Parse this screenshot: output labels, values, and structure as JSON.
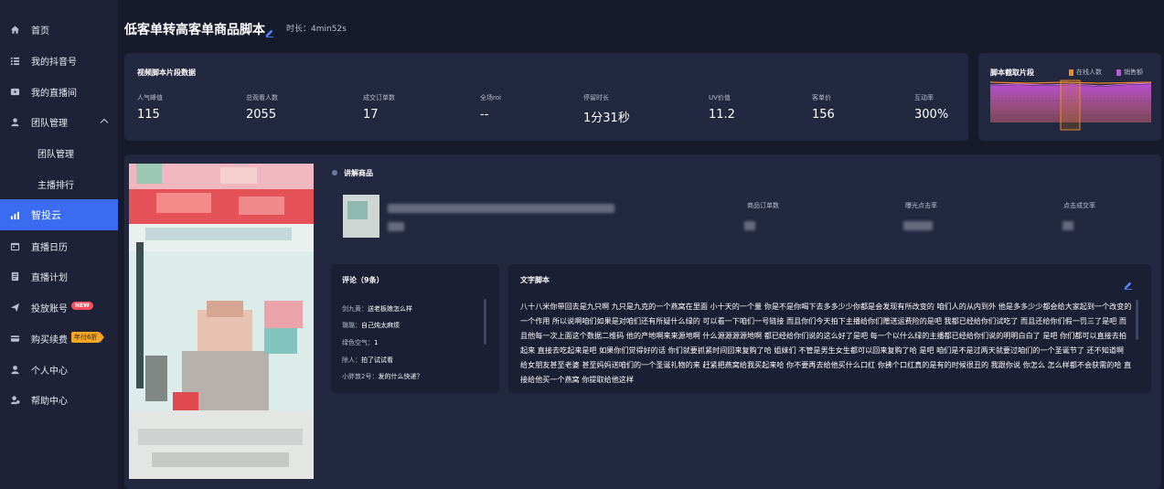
{
  "sidebar": {
    "items": [
      {
        "label": "首页",
        "icon": "home-icon"
      },
      {
        "label": "我的抖音号",
        "icon": "list-icon"
      },
      {
        "label": "我的直播间",
        "icon": "live-icon"
      },
      {
        "label": "团队管理",
        "icon": "team-icon"
      },
      {
        "label": "团队管理",
        "icon": ""
      },
      {
        "label": "主播排行",
        "icon": ""
      },
      {
        "label": "智投云",
        "icon": "chart-icon"
      },
      {
        "label": "直播日历",
        "icon": "calendar-icon"
      },
      {
        "label": "直播计划",
        "icon": "plan-icon"
      },
      {
        "label": "投放账号",
        "icon": "send-icon",
        "badge": "NEW"
      },
      {
        "label": "购买续费",
        "icon": "card-icon",
        "badge": "年付6折"
      },
      {
        "label": "个人中心",
        "icon": "user-icon"
      },
      {
        "label": "帮助中心",
        "icon": "help-icon"
      }
    ]
  },
  "header": {
    "title": "低客单转高客单商品脚本",
    "duration": "时长：4min52s"
  },
  "stats": {
    "title": "视频脚本片段数据",
    "items": [
      {
        "label": "人气峰值",
        "value": "115"
      },
      {
        "label": "总观看人数",
        "value": "2055"
      },
      {
        "label": "成交订单数",
        "value": "17"
      },
      {
        "label": "全场roi",
        "value": "--"
      },
      {
        "label": "停留时长",
        "value": "1分31秒"
      },
      {
        "label": "UV价值",
        "value": "11.2"
      },
      {
        "label": "客单价",
        "value": "156"
      },
      {
        "label": "互动率",
        "value": "300%"
      }
    ]
  },
  "clip": {
    "title": "脚本截取片段",
    "legend": [
      {
        "name": "在线人数",
        "color": "#f08a24"
      },
      {
        "name": "销售额",
        "color": "#c552e0"
      }
    ]
  },
  "product": {
    "section_title": "讲解商品",
    "columns": [
      "商品订单数",
      "曝光点击率",
      "点击成交率"
    ]
  },
  "comments": {
    "title": "评论（9条）",
    "items": [
      {
        "user": "剑九黄：",
        "text": "送老板娘怎么样"
      },
      {
        "user": "璐璐：",
        "text": "自己炖太麻烦"
      },
      {
        "user": "绿色空气：",
        "text": "1"
      },
      {
        "user": "除人：",
        "text": "拍了试试看"
      },
      {
        "user": "小胖敦2号：",
        "text": "发的什么快递？"
      }
    ]
  },
  "script": {
    "title": "文字脚本",
    "text": "八十八米你带回去是九只啊 九只是九克的一个燕窝在里面 小十天的一个量 你是不是你喝下去多多少少你都是会发现有所改变的 咱们人的从内到外 他是多多少少都会给大家起到一个改变的一个作用 所以说啊咱们如果是对咱们还有所疑什么绿的 可以看一下咱们一号链接 而且你们今天拍下主播给你们赠送运费险的是吧 我都已经给你们试吃了 而且还给你们假一罚三了是吧 而且他每一次上面这个数据二维码 他的产地啊来来源地啊 什么源源源源地啊 都已经给你们说的这么好了是吧 每一个以什么绿的主播都已经给你们说的明明白白了 是吧 你们都可以直接去拍起来 直接去吃起来是吧 如果你们觉得好的话 你们就要抓紧时间回来复购了哈 姐妹们 不管是男生女生都可以回来复购了哈 是吧 咱们是不是过两天就要过咱们的一个圣诞节了 还不知道啊 给女朋友甚至老婆 甚至妈妈送咱们的一个圣诞礼物的来 赶紧把燕窝给我买起来哈 你不要再去给他买什么口红 你拂个口红真的是有的时候很丑的 我跟你说 你怎么 怎么样都不会获需的哈 直接给他买一个燕窝 你提取给他这样"
  }
}
